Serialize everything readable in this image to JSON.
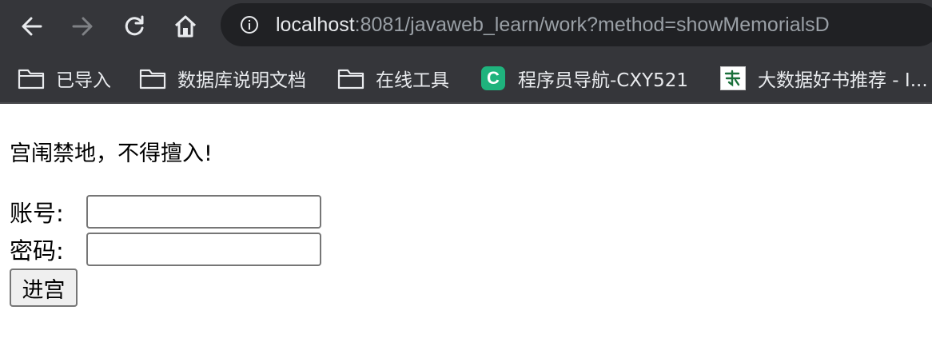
{
  "browser": {
    "url_host": "localhost",
    "url_rest": ":8081/javaweb_learn/work?method=showMemorialsD",
    "icons": {
      "back": "arrow-left-icon",
      "forward": "arrow-right-icon",
      "reload": "reload-icon",
      "home": "home-icon",
      "site_info": "info-icon"
    }
  },
  "bookmarks": [
    {
      "label": "已导入",
      "icon": "folder-icon"
    },
    {
      "label": "数据库说明文档",
      "icon": "folder-icon"
    },
    {
      "label": "在线工具",
      "icon": "folder-icon"
    },
    {
      "label": "程序员导航-CXY521",
      "icon": "cxy-logo-icon",
      "icon_letter": "C",
      "icon_color": "#1fb37d"
    },
    {
      "label": "大数据好书推荐 - I...",
      "icon": "book-favicon-icon"
    }
  ],
  "page": {
    "heading": "宫闱禁地，不得擅入!",
    "account_label": "账号:",
    "account_value": "",
    "password_label": "密码:",
    "password_value": "",
    "submit_label": "进宫"
  }
}
